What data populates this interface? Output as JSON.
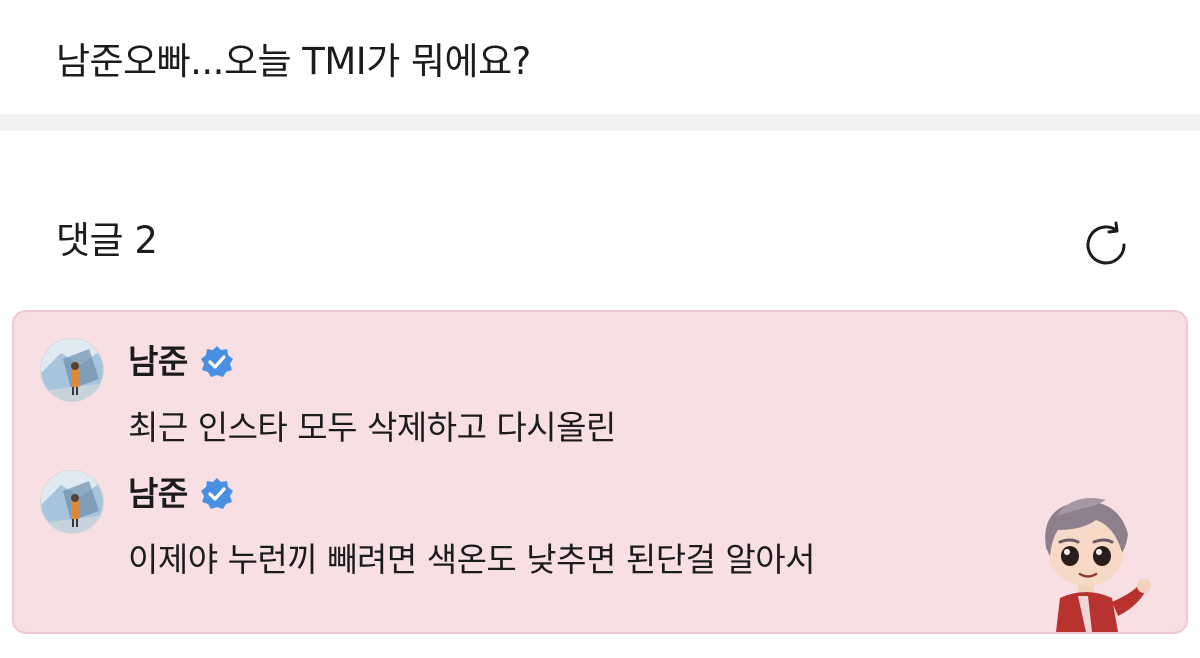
{
  "post": {
    "title": "남준오빠...오늘 TMI가 뭐에요?"
  },
  "comments_section": {
    "label": "댓글 2",
    "refresh_icon": "refresh-icon"
  },
  "comments": [
    {
      "author": "남준",
      "verified": true,
      "text": "최근 인스타 모두 삭제하고 다시올린"
    },
    {
      "author": "남준",
      "verified": true,
      "text": "이제야 누런끼 빼려면 색온도 낮추면 된단걸 알아서"
    }
  ],
  "colors": {
    "comment_box_bg": "#f8dfe3",
    "comment_box_border": "#f0c9d0",
    "verified_badge": "#4a90e2",
    "divider": "#f2f2f5"
  },
  "icons": {
    "verified": "verified-badge-icon",
    "sticker": "character-sticker"
  }
}
